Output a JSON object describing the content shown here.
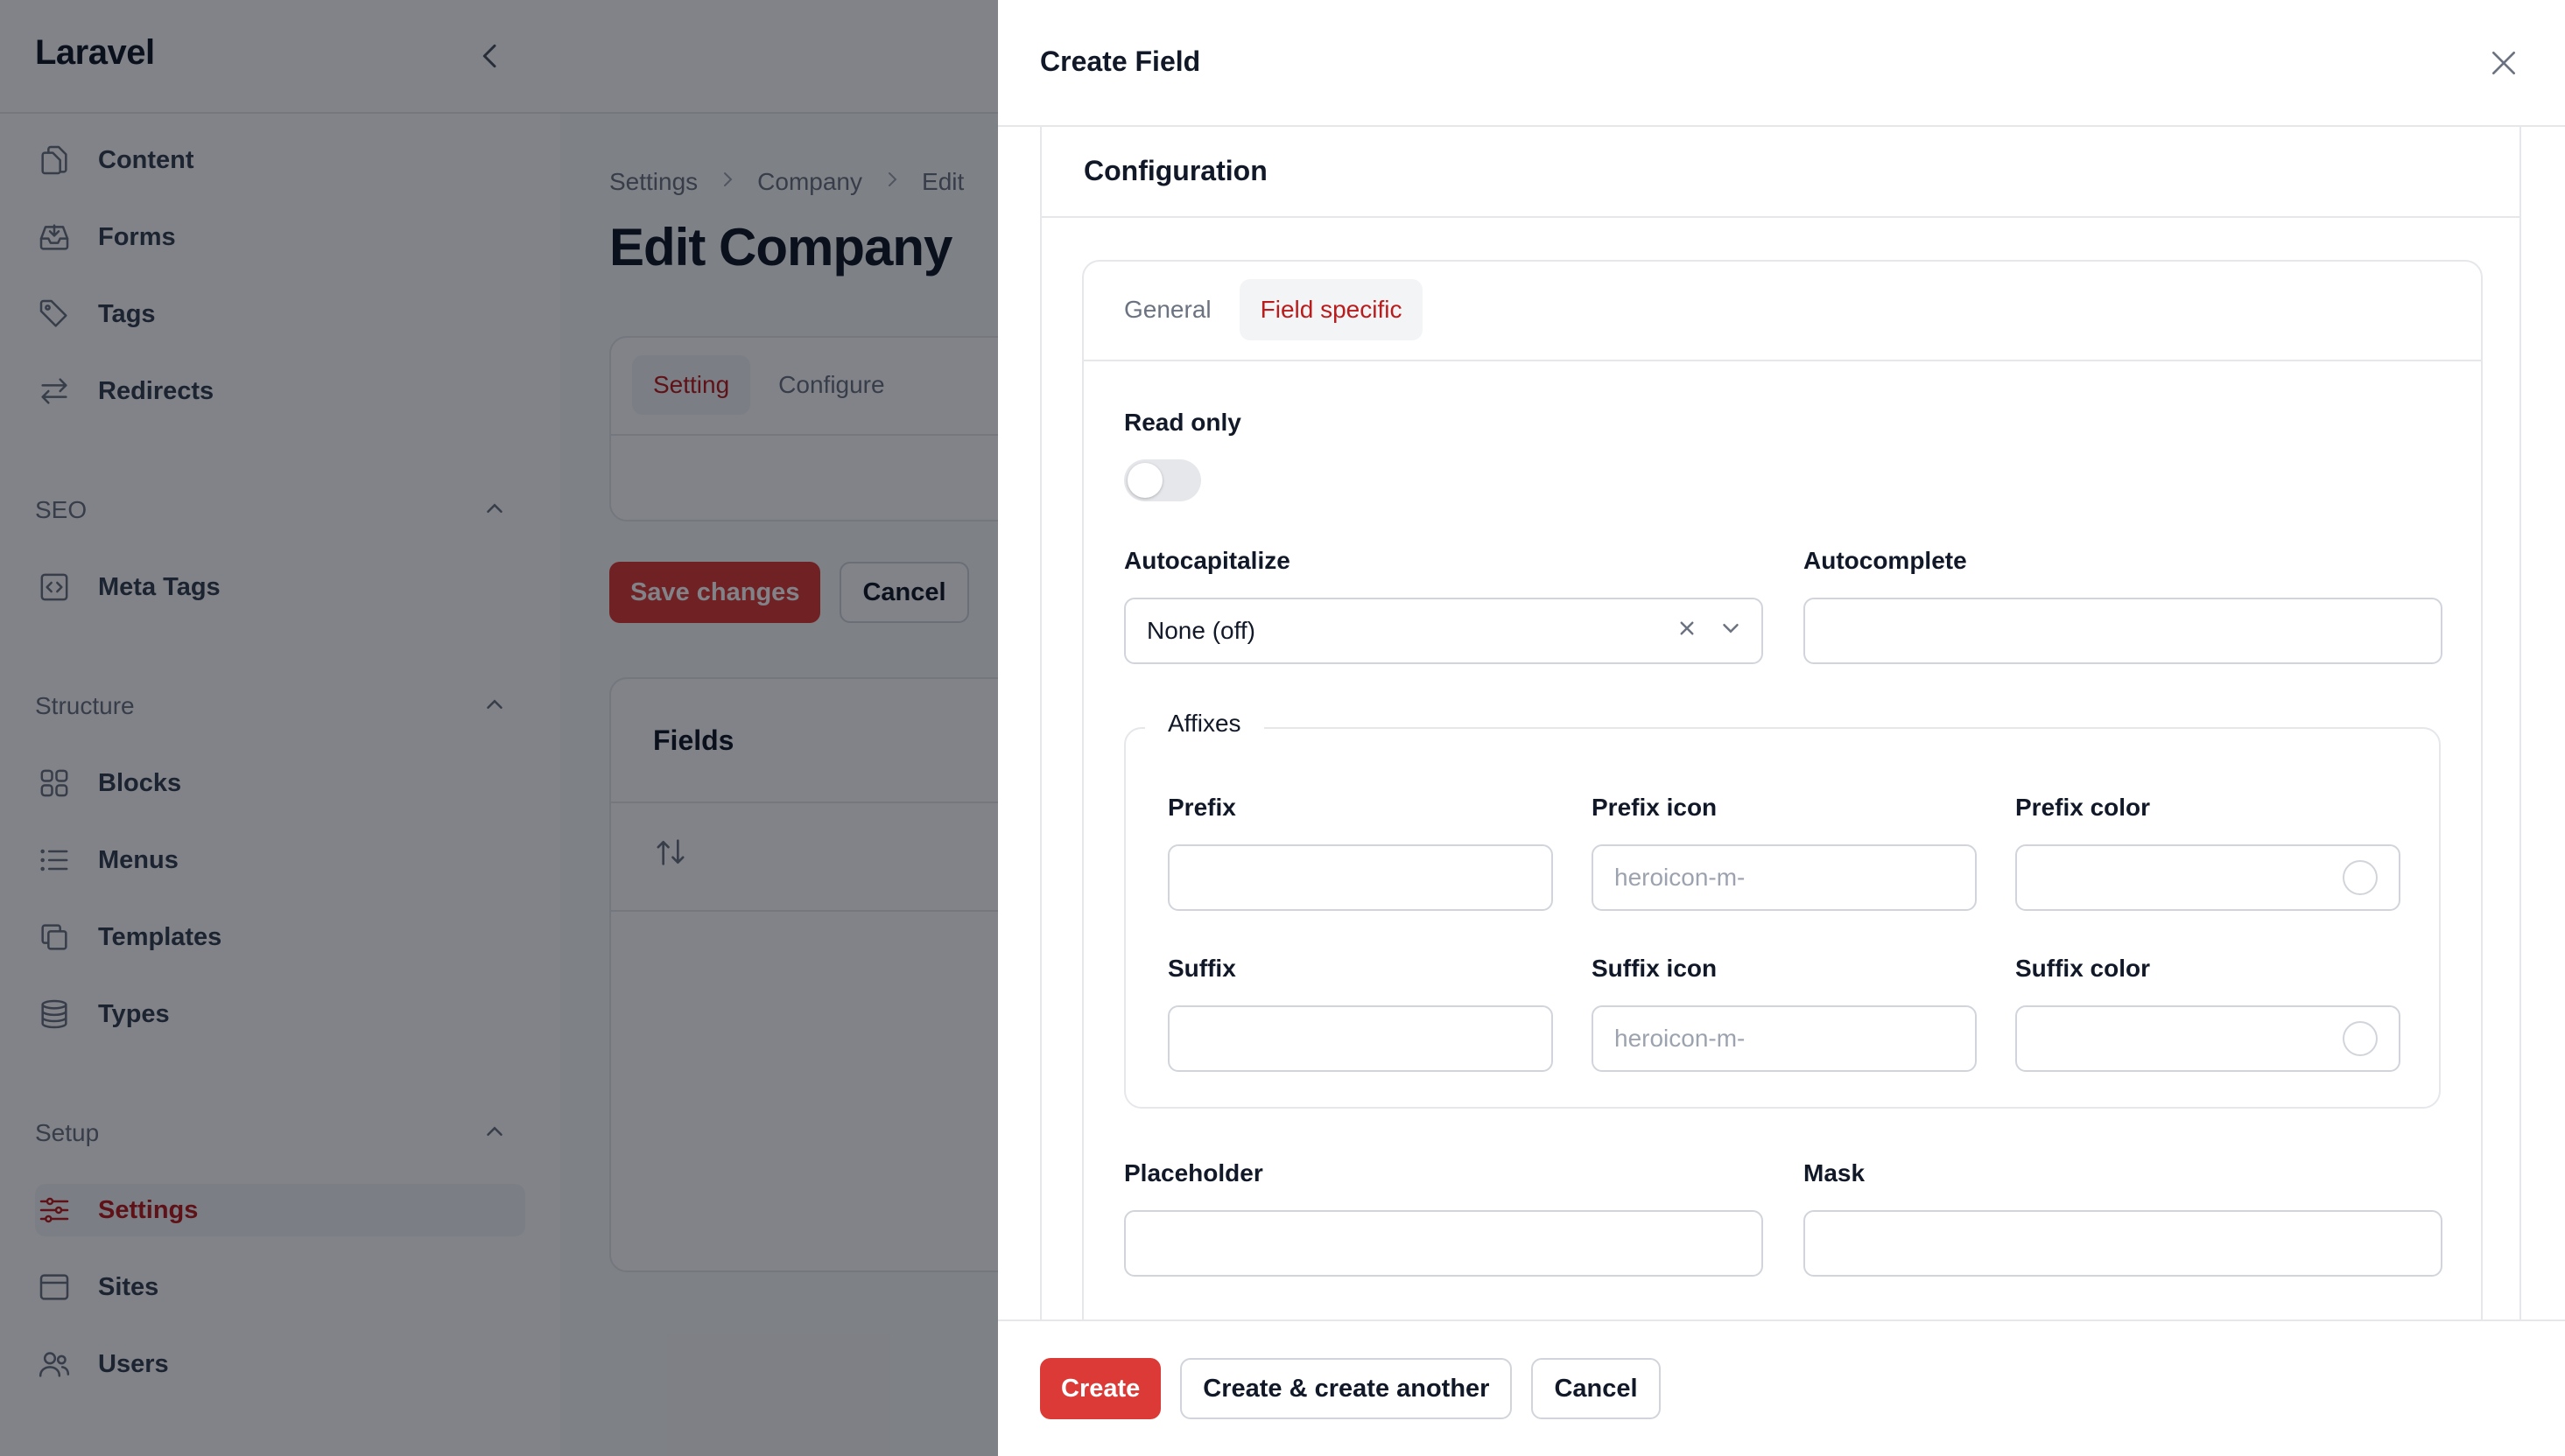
{
  "app": {
    "brand": "Laravel",
    "sidebar": {
      "top_items": [
        {
          "label": "Content",
          "icon": "document-duplicate-icon"
        },
        {
          "label": "Forms",
          "icon": "inbox-arrow-icon"
        },
        {
          "label": "Tags",
          "icon": "tag-icon"
        },
        {
          "label": "Redirects",
          "icon": "arrows-right-left-icon"
        }
      ],
      "groups": [
        {
          "label": "SEO",
          "items": [
            {
              "label": "Meta Tags",
              "icon": "code-bracket-square-icon"
            }
          ]
        },
        {
          "label": "Structure",
          "items": [
            {
              "label": "Blocks",
              "icon": "squares-2x2-icon"
            },
            {
              "label": "Menus",
              "icon": "list-bullet-icon"
            },
            {
              "label": "Templates",
              "icon": "square-2-stack-icon"
            },
            {
              "label": "Types",
              "icon": "circle-stack-icon"
            }
          ]
        },
        {
          "label": "Setup",
          "items": [
            {
              "label": "Settings",
              "icon": "adjustments-icon",
              "active": true
            },
            {
              "label": "Sites",
              "icon": "window-icon"
            },
            {
              "label": "Users",
              "icon": "users-icon"
            }
          ]
        }
      ]
    },
    "breadcrumbs": [
      "Settings",
      "Company",
      "Edit"
    ],
    "page_title": "Edit Company",
    "page_tabs": [
      "Setting",
      "Configure"
    ],
    "page_active_tab": "Setting",
    "save_label": "Save changes",
    "cancel_label": "Cancel",
    "fields_title": "Fields"
  },
  "modal": {
    "title": "Create Field",
    "section_title": "Configuration",
    "tabs": [
      "General",
      "Field specific"
    ],
    "active_tab": "Field specific",
    "read_only_label": "Read only",
    "read_only_value": false,
    "autocapitalize": {
      "label": "Autocapitalize",
      "value": "None (off)"
    },
    "autocomplete": {
      "label": "Autocomplete",
      "value": ""
    },
    "affixes": {
      "legend": "Affixes",
      "prefix": {
        "label": "Prefix",
        "value": ""
      },
      "prefix_icon": {
        "label": "Prefix icon",
        "placeholder": "heroicon-m-"
      },
      "prefix_color": {
        "label": "Prefix color",
        "value": ""
      },
      "suffix": {
        "label": "Suffix",
        "value": ""
      },
      "suffix_icon": {
        "label": "Suffix icon",
        "placeholder": "heroicon-m-"
      },
      "suffix_color": {
        "label": "Suffix color",
        "value": ""
      }
    },
    "placeholder": {
      "label": "Placeholder",
      "value": ""
    },
    "mask": {
      "label": "Mask",
      "value": ""
    },
    "footer": {
      "create": "Create",
      "create_another": "Create & create another",
      "cancel": "Cancel"
    }
  },
  "colors": {
    "primary": "#dc3a36",
    "active_text": "#b91c1c",
    "overlay": "rgba(3,7,18,0.5)"
  }
}
